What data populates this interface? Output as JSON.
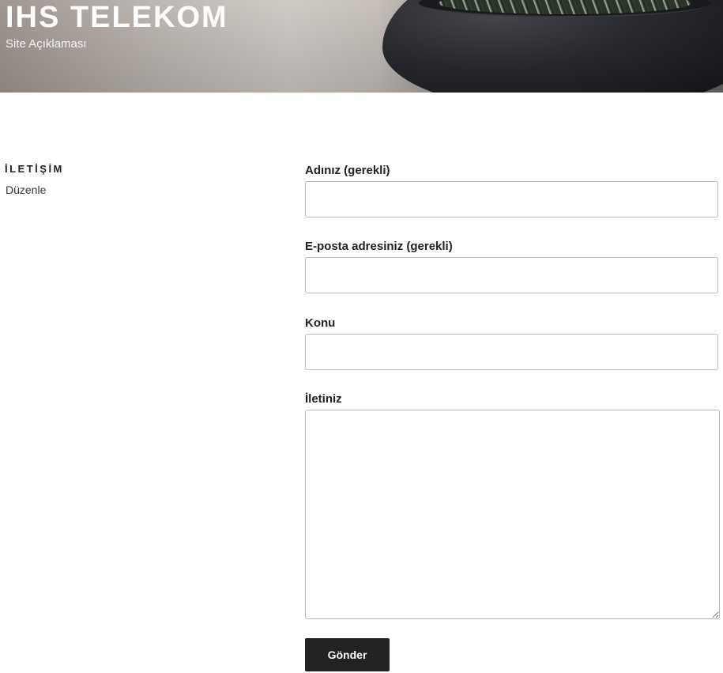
{
  "header": {
    "site_title": "IHS TELEKOM",
    "site_description": "Site Açıklaması"
  },
  "sidebar": {
    "widget_title": "İLETİŞİM",
    "edit_link": "Düzenle"
  },
  "form": {
    "name_label": "Adınız (gerekli)",
    "name_value": "",
    "email_label": "E-posta adresiniz (gerekli)",
    "email_value": "",
    "subject_label": "Konu",
    "subject_value": "",
    "message_label": "İletiniz",
    "message_value": "",
    "submit_label": "Gönder"
  },
  "colors": {
    "button_bg": "#222222",
    "button_text": "#ffffff",
    "field_border": "#bbbbbb"
  }
}
